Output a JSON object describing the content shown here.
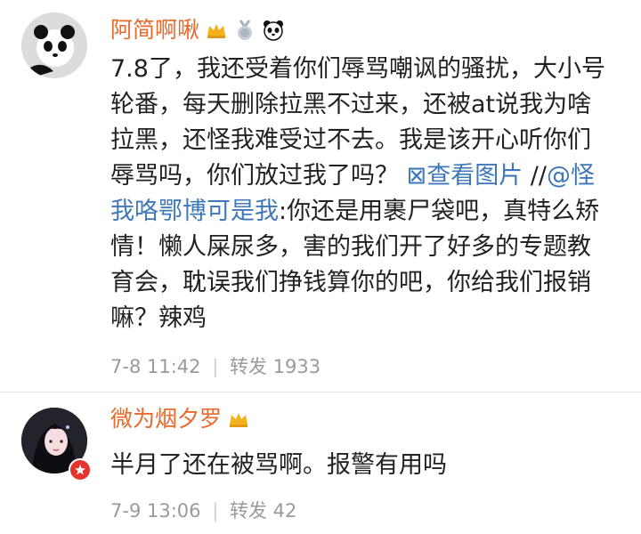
{
  "comments": [
    {
      "username": "阿简啊啾",
      "badges": [
        "crown-icon",
        "medal-icon",
        "panda-icon"
      ],
      "text_main": "7.8了，我还受着你们辱骂嘲讽的骚扰，大小号轮番，每天删除拉黑不过来，还被at说我为啥拉黑，还怪我难受过不去。我是该开心听你们辱骂吗，你们放过我了吗？",
      "view_image_label": "查看图片",
      "repost_prefix": " //",
      "mention": "@怪我咯鄂博可是我",
      "quoted_text": ":你还是用裹尸袋吧，真特么矫情！懒人屎尿多，害的我们开了好多的专题教育会，耽误我们挣钱算你的吧，你给我们报销嘛？辣鸡",
      "date": "7-8 11:42",
      "separator": "|",
      "repost_label": "转发",
      "repost_count": "1933"
    },
    {
      "username": "微为烟夕罗",
      "badges": [
        "crown-icon"
      ],
      "text_main": "半月了还在被骂啊。报警有用吗",
      "date": "7-9 13:06",
      "separator": "|",
      "repost_label": "转发",
      "repost_count": "42"
    }
  ],
  "colors": {
    "username": "#e86b2b",
    "link": "#3f78b8",
    "meta": "#9a9a9a",
    "vbadge": "#e3332f"
  }
}
